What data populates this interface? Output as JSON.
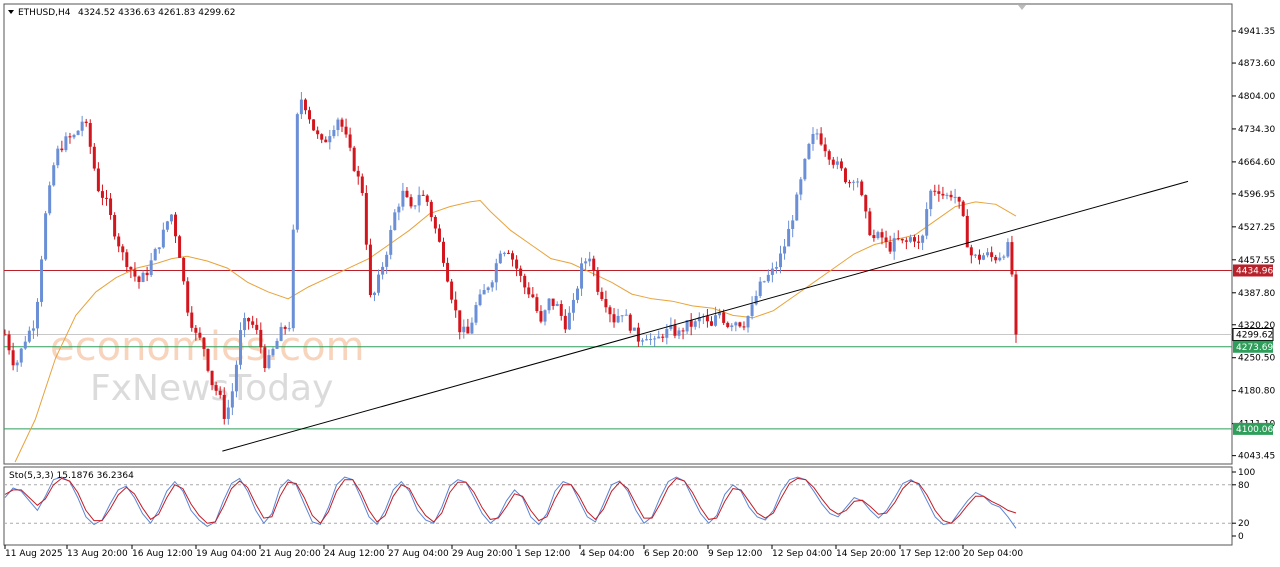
{
  "header": {
    "symbol": "ETHUSD,H4",
    "ohlc": "4324.52 4336.63 4261.83 4299.62",
    "oscillator": "Sto(5,3,3) 15.1876 36.2364"
  },
  "watermark": {
    "line1": "economies.com",
    "line2": "FxNewsToday"
  },
  "colors": {
    "bull": "#6a8fd6",
    "bear": "#d3151d",
    "ma": "#e8a33b",
    "resistance": "#b8202a",
    "support": "#2e9e5a",
    "trend": "#000000",
    "stoch_main": "#5b85d6",
    "stoch_signal": "#c31d25"
  },
  "price_tags": {
    "resistance": "4434.96",
    "current": "4299.62",
    "support1": "4273.69",
    "support2": "4100.06"
  },
  "chart_data": {
    "type": "candlestick",
    "price_ticks": [
      "4941.35",
      "4873.60",
      "4804.00",
      "4734.30",
      "4664.60",
      "4596.95",
      "4527.25",
      "4457.55",
      "4387.80",
      "4320.20",
      "4250.50",
      "4180.80",
      "4111.10",
      "4043.45"
    ],
    "ylim": [
      4030,
      4990
    ],
    "stoch_ticks": [
      "100",
      "80",
      "20",
      "0"
    ],
    "stoch_levels": [
      80,
      20
    ],
    "time_labels": [
      "11 Aug 2025",
      "13 Aug 20:00",
      "16 Aug 12:00",
      "19 Aug 04:00",
      "21 Aug 20:00",
      "24 Aug 12:00",
      "27 Aug 04:00",
      "29 Aug 20:00",
      "1 Sep 12:00",
      "4 Sep 04:00",
      "6 Sep 20:00",
      "9 Sep 12:00",
      "12 Sep 04:00",
      "14 Sep 20:00",
      "17 Sep 12:00",
      "20 Sep 04:00"
    ],
    "horizontal_levels": [
      4434.96,
      4299.62,
      4273.69,
      4100.06
    ],
    "trendline": {
      "from": [
        0.215,
        4053
      ],
      "to": [
        0.935,
        4483
      ]
    },
    "close_path": [
      [
        0.0,
        4300
      ],
      [
        0.01,
        4230
      ],
      [
        0.02,
        4290
      ],
      [
        0.03,
        4330
      ],
      [
        0.04,
        4550
      ],
      [
        0.05,
        4680
      ],
      [
        0.06,
        4710
      ],
      [
        0.07,
        4720
      ],
      [
        0.078,
        4760
      ],
      [
        0.085,
        4690
      ],
      [
        0.092,
        4610
      ],
      [
        0.1,
        4580
      ],
      [
        0.108,
        4520
      ],
      [
        0.116,
        4470
      ],
      [
        0.124,
        4440
      ],
      [
        0.132,
        4410
      ],
      [
        0.14,
        4430
      ],
      [
        0.148,
        4470
      ],
      [
        0.156,
        4510
      ],
      [
        0.164,
        4560
      ],
      [
        0.172,
        4480
      ],
      [
        0.18,
        4360
      ],
      [
        0.188,
        4300
      ],
      [
        0.196,
        4280
      ],
      [
        0.204,
        4200
      ],
      [
        0.212,
        4170
      ],
      [
        0.218,
        4120
      ],
      [
        0.226,
        4190
      ],
      [
        0.234,
        4320
      ],
      [
        0.242,
        4330
      ],
      [
        0.25,
        4300
      ],
      [
        0.258,
        4230
      ],
      [
        0.266,
        4270
      ],
      [
        0.274,
        4310
      ],
      [
        0.282,
        4320
      ],
      [
        0.29,
        4810
      ],
      [
        0.298,
        4780
      ],
      [
        0.306,
        4730
      ],
      [
        0.314,
        4700
      ],
      [
        0.322,
        4730
      ],
      [
        0.33,
        4760
      ],
      [
        0.338,
        4710
      ],
      [
        0.346,
        4650
      ],
      [
        0.354,
        4600
      ],
      [
        0.362,
        4360
      ],
      [
        0.37,
        4420
      ],
      [
        0.378,
        4480
      ],
      [
        0.386,
        4560
      ],
      [
        0.394,
        4600
      ],
      [
        0.402,
        4560
      ],
      [
        0.41,
        4600
      ],
      [
        0.418,
        4580
      ],
      [
        0.426,
        4520
      ],
      [
        0.434,
        4460
      ],
      [
        0.442,
        4380
      ],
      [
        0.45,
        4310
      ],
      [
        0.458,
        4300
      ],
      [
        0.466,
        4360
      ],
      [
        0.474,
        4390
      ],
      [
        0.482,
        4420
      ],
      [
        0.49,
        4480
      ],
      [
        0.498,
        4480
      ],
      [
        0.506,
        4440
      ],
      [
        0.514,
        4400
      ],
      [
        0.522,
        4380
      ],
      [
        0.53,
        4320
      ],
      [
        0.538,
        4370
      ],
      [
        0.546,
        4360
      ],
      [
        0.554,
        4320
      ],
      [
        0.562,
        4360
      ],
      [
        0.57,
        4440
      ],
      [
        0.578,
        4470
      ],
      [
        0.586,
        4400
      ],
      [
        0.594,
        4370
      ],
      [
        0.602,
        4330
      ],
      [
        0.61,
        4350
      ],
      [
        0.618,
        4320
      ],
      [
        0.626,
        4290
      ],
      [
        0.634,
        4300
      ],
      [
        0.642,
        4280
      ],
      [
        0.65,
        4300
      ],
      [
        0.658,
        4310
      ],
      [
        0.666,
        4300
      ],
      [
        0.674,
        4320
      ],
      [
        0.682,
        4320
      ],
      [
        0.69,
        4340
      ],
      [
        0.698,
        4310
      ],
      [
        0.706,
        4350
      ],
      [
        0.714,
        4320
      ],
      [
        0.722,
        4330
      ],
      [
        0.73,
        4320
      ],
      [
        0.738,
        4350
      ],
      [
        0.746,
        4400
      ],
      [
        0.754,
        4420
      ],
      [
        0.762,
        4440
      ],
      [
        0.77,
        4480
      ],
      [
        0.778,
        4540
      ],
      [
        0.786,
        4610
      ],
      [
        0.794,
        4690
      ],
      [
        0.802,
        4730
      ],
      [
        0.81,
        4700
      ],
      [
        0.818,
        4670
      ],
      [
        0.826,
        4650
      ],
      [
        0.834,
        4620
      ],
      [
        0.842,
        4640
      ],
      [
        0.85,
        4560
      ],
      [
        0.858,
        4500
      ],
      [
        0.866,
        4510
      ],
      [
        0.874,
        4480
      ],
      [
        0.882,
        4500
      ],
      [
        0.89,
        4490
      ],
      [
        0.898,
        4510
      ],
      [
        0.906,
        4480
      ],
      [
        0.914,
        4600
      ],
      [
        0.922,
        4610
      ],
      [
        0.93,
        4590
      ],
      [
        0.938,
        4600
      ],
      [
        0.946,
        4560
      ],
      [
        0.954,
        4470
      ],
      [
        0.962,
        4460
      ],
      [
        0.97,
        4470
      ],
      [
        0.978,
        4460
      ],
      [
        0.986,
        4470
      ],
      [
        0.994,
        4490
      ],
      [
        1.0,
        4300
      ]
    ],
    "ma_path": [
      [
        0.01,
        4030
      ],
      [
        0.03,
        4120
      ],
      [
        0.05,
        4250
      ],
      [
        0.07,
        4340
      ],
      [
        0.09,
        4390
      ],
      [
        0.11,
        4420
      ],
      [
        0.13,
        4440
      ],
      [
        0.15,
        4450
      ],
      [
        0.165,
        4460
      ],
      [
        0.18,
        4465
      ],
      [
        0.2,
        4455
      ],
      [
        0.22,
        4440
      ],
      [
        0.24,
        4410
      ],
      [
        0.26,
        4390
      ],
      [
        0.28,
        4375
      ],
      [
        0.3,
        4400
      ],
      [
        0.32,
        4420
      ],
      [
        0.34,
        4440
      ],
      [
        0.36,
        4460
      ],
      [
        0.38,
        4490
      ],
      [
        0.4,
        4520
      ],
      [
        0.42,
        4555
      ],
      [
        0.44,
        4570
      ],
      [
        0.46,
        4580
      ],
      [
        0.47,
        4583
      ],
      [
        0.48,
        4560
      ],
      [
        0.5,
        4520
      ],
      [
        0.52,
        4490
      ],
      [
        0.54,
        4460
      ],
      [
        0.56,
        4450
      ],
      [
        0.58,
        4430
      ],
      [
        0.6,
        4410
      ],
      [
        0.62,
        4385
      ],
      [
        0.64,
        4375
      ],
      [
        0.66,
        4370
      ],
      [
        0.68,
        4360
      ],
      [
        0.7,
        4355
      ],
      [
        0.72,
        4340
      ],
      [
        0.74,
        4335
      ],
      [
        0.76,
        4350
      ],
      [
        0.78,
        4380
      ],
      [
        0.8,
        4410
      ],
      [
        0.82,
        4440
      ],
      [
        0.84,
        4470
      ],
      [
        0.86,
        4490
      ],
      [
        0.88,
        4500
      ],
      [
        0.9,
        4510
      ],
      [
        0.92,
        4540
      ],
      [
        0.94,
        4570
      ],
      [
        0.96,
        4580
      ],
      [
        0.98,
        4575
      ],
      [
        1.0,
        4550
      ]
    ],
    "stochastic": {
      "main": [
        60,
        75,
        70,
        55,
        40,
        62,
        88,
        92,
        85,
        60,
        30,
        18,
        25,
        50,
        72,
        78,
        60,
        35,
        20,
        40,
        70,
        85,
        70,
        40,
        25,
        15,
        22,
        55,
        82,
        90,
        70,
        40,
        20,
        35,
        75,
        88,
        80,
        50,
        22,
        18,
        45,
        80,
        92,
        88,
        60,
        30,
        18,
        40,
        72,
        85,
        70,
        40,
        25,
        20,
        45,
        78,
        88,
        84,
        60,
        35,
        20,
        30,
        55,
        72,
        60,
        30,
        18,
        35,
        70,
        85,
        80,
        55,
        30,
        22,
        50,
        80,
        86,
        70,
        40,
        20,
        30,
        60,
        85,
        92,
        86,
        60,
        35,
        20,
        32,
        65,
        80,
        70,
        45,
        30,
        25,
        40,
        70,
        88,
        92,
        88,
        70,
        50,
        35,
        30,
        45,
        60,
        55,
        40,
        28,
        40,
        60,
        82,
        88,
        80,
        55,
        30,
        18,
        20,
        38,
        55,
        68,
        62,
        50,
        45,
        30,
        12
      ],
      "signal": [
        65,
        72,
        72,
        60,
        48,
        58,
        80,
        90,
        86,
        68,
        40,
        24,
        24,
        42,
        64,
        76,
        66,
        44,
        26,
        34,
        60,
        80,
        74,
        50,
        32,
        20,
        22,
        46,
        74,
        86,
        76,
        50,
        28,
        30,
        62,
        84,
        82,
        60,
        32,
        20,
        38,
        70,
        88,
        88,
        68,
        40,
        22,
        32,
        62,
        80,
        74,
        50,
        32,
        22,
        36,
        68,
        84,
        84,
        68,
        44,
        26,
        28,
        46,
        66,
        62,
        40,
        24,
        30,
        58,
        80,
        80,
        62,
        38,
        26,
        42,
        70,
        84,
        74,
        50,
        28,
        28,
        50,
        76,
        90,
        86,
        68,
        44,
        26,
        28,
        54,
        74,
        72,
        54,
        36,
        28,
        36,
        60,
        82,
        90,
        88,
        76,
        58,
        42,
        34,
        40,
        54,
        56,
        46,
        34,
        36,
        52,
        74,
        86,
        82,
        64,
        40,
        24,
        20,
        32,
        48,
        62,
        62,
        54,
        48,
        40,
        36
      ]
    }
  }
}
